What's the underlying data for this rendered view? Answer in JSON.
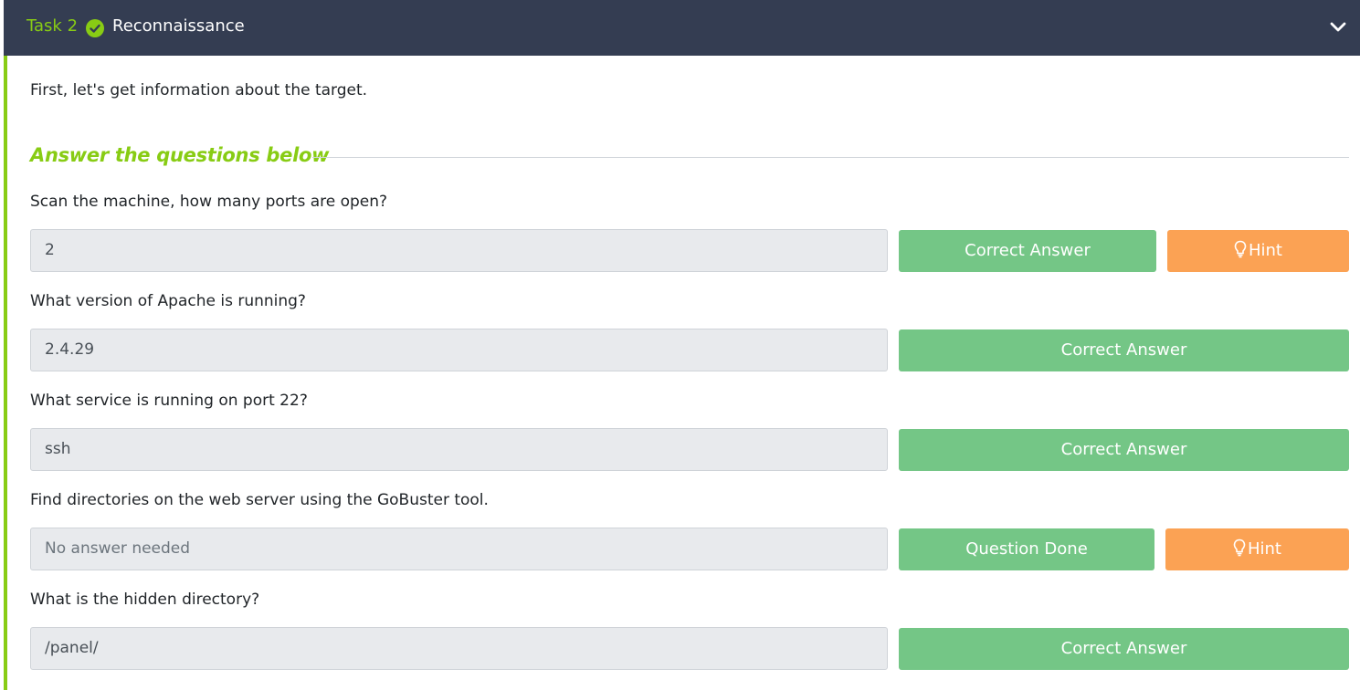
{
  "task": {
    "label": "Task 2",
    "title": "Reconnaissance",
    "intro": "First, let's get information about the target.",
    "section_heading": "Answer the questions below"
  },
  "questions": [
    {
      "text": "Scan the machine, how many ports are open?",
      "answer": "2",
      "button_label": "Correct Answer",
      "hint_label": "Hint"
    },
    {
      "text": "What version of Apache is running?",
      "answer": "2.4.29",
      "button_label": "Correct Answer"
    },
    {
      "text": "What service is running on port 22?",
      "answer": "ssh",
      "button_label": "Correct Answer"
    },
    {
      "text": "Find directories on the web server using the GoBuster tool.",
      "placeholder": "No answer needed",
      "button_label": "Question Done",
      "hint_label": "Hint"
    },
    {
      "text": "What is the hidden directory?",
      "answer": "/panel/",
      "button_label": "Correct Answer"
    }
  ],
  "icons": {
    "completed": "check-circle-icon",
    "collapse": "chevron-down-icon",
    "hint": "lightbulb-icon"
  },
  "colors": {
    "header_bg": "#343d52",
    "accent": "#88cc14",
    "success_button": "#74c686",
    "hint_button": "#fba254"
  }
}
